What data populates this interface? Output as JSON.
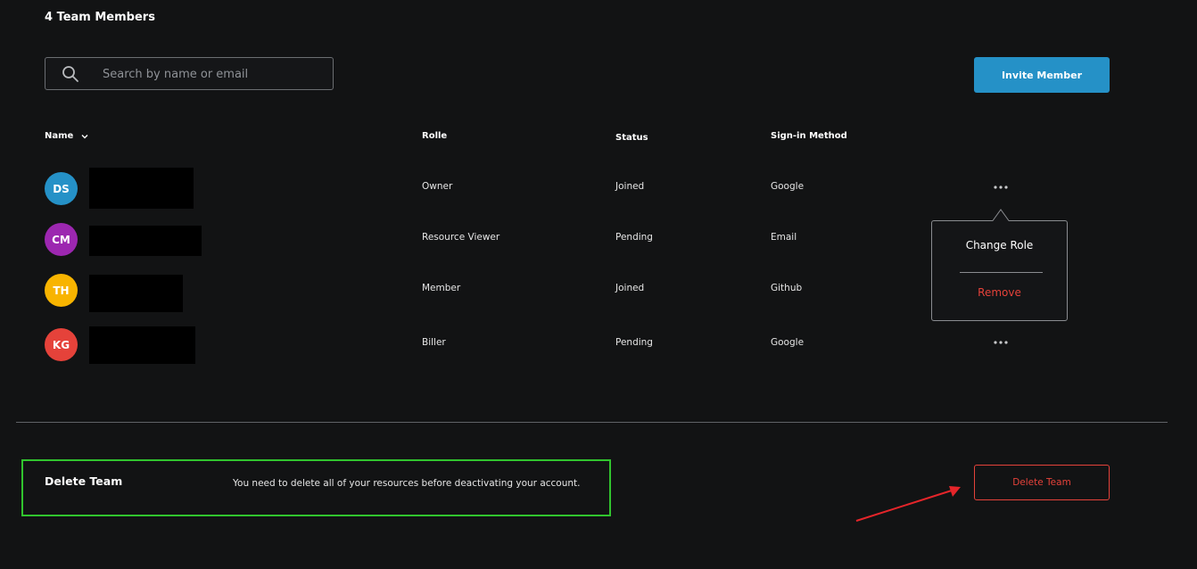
{
  "header": {
    "title": "4 Team Members"
  },
  "search": {
    "placeholder": "Search by name or email",
    "icon": "search-icon"
  },
  "toolbar": {
    "invite_label": "Invite Member"
  },
  "table": {
    "columns": {
      "name": "Name",
      "role": "Rolle",
      "status": "Status",
      "signin": "Sign-in Method"
    },
    "rows": [
      {
        "initials": "DS",
        "avatar_color": "#2591c7",
        "role": "Owner",
        "status": "Joined",
        "signin": "Google"
      },
      {
        "initials": "CM",
        "avatar_color": "#9c27b0",
        "role": "Resource Viewer",
        "status": "Pending",
        "signin": "Email"
      },
      {
        "initials": "TH",
        "avatar_color": "#f8b400",
        "role": "Member",
        "status": "Joined",
        "signin": "Github"
      },
      {
        "initials": "KG",
        "avatar_color": "#e5423a",
        "role": "Biller",
        "status": "Pending",
        "signin": "Google"
      }
    ]
  },
  "row_menu": {
    "change_role": "Change Role",
    "remove": "Remove"
  },
  "danger_zone": {
    "title": "Delete Team",
    "description": "You need to delete all of your resources before deactivating your account.",
    "button_label": "Delete Team"
  },
  "colors": {
    "background": "#121314",
    "accent": "#2591c7",
    "danger": "#e5423a",
    "highlight": "#31c42e"
  }
}
